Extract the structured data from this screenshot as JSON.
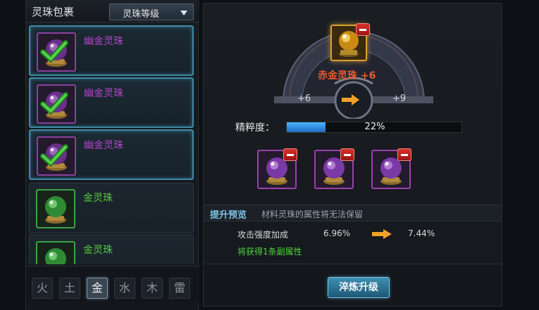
{
  "bag": {
    "title": "灵珠包裹",
    "sort_label": "灵珠等级",
    "items": [
      {
        "name": "幽金灵珠",
        "rarity": "purple",
        "selected": true
      },
      {
        "name": "幽金灵珠",
        "rarity": "purple",
        "selected": true
      },
      {
        "name": "幽金灵珠",
        "rarity": "purple",
        "selected": true
      },
      {
        "name": "金灵珠",
        "rarity": "green",
        "selected": false
      },
      {
        "name": "金灵珠",
        "rarity": "green",
        "selected": false
      }
    ],
    "element_tabs": [
      "火",
      "土",
      "金",
      "水",
      "木",
      "雷"
    ],
    "active_element": "金"
  },
  "target": {
    "name": "赤金灵珠 +6",
    "level_from": "+6",
    "level_to": "+9"
  },
  "essence": {
    "label": "精粹度：",
    "percent_text": "22%",
    "value": 0.22
  },
  "preview": {
    "title": "提升预览",
    "note": "材料灵珠的属性将无法保留",
    "stat_label": "攻击强度加成",
    "stat_current": "6.96%",
    "stat_next": "7.44%",
    "extra": "将获得1条副属性"
  },
  "action": {
    "refine_label": "淬炼升级"
  },
  "colors": {
    "purple_orb": "#8c3f9e",
    "green_orb": "#3ea347",
    "gold_orb": "#d9a02c",
    "accent_blue": "#3f8aa3",
    "remove_red": "#d8312c"
  }
}
